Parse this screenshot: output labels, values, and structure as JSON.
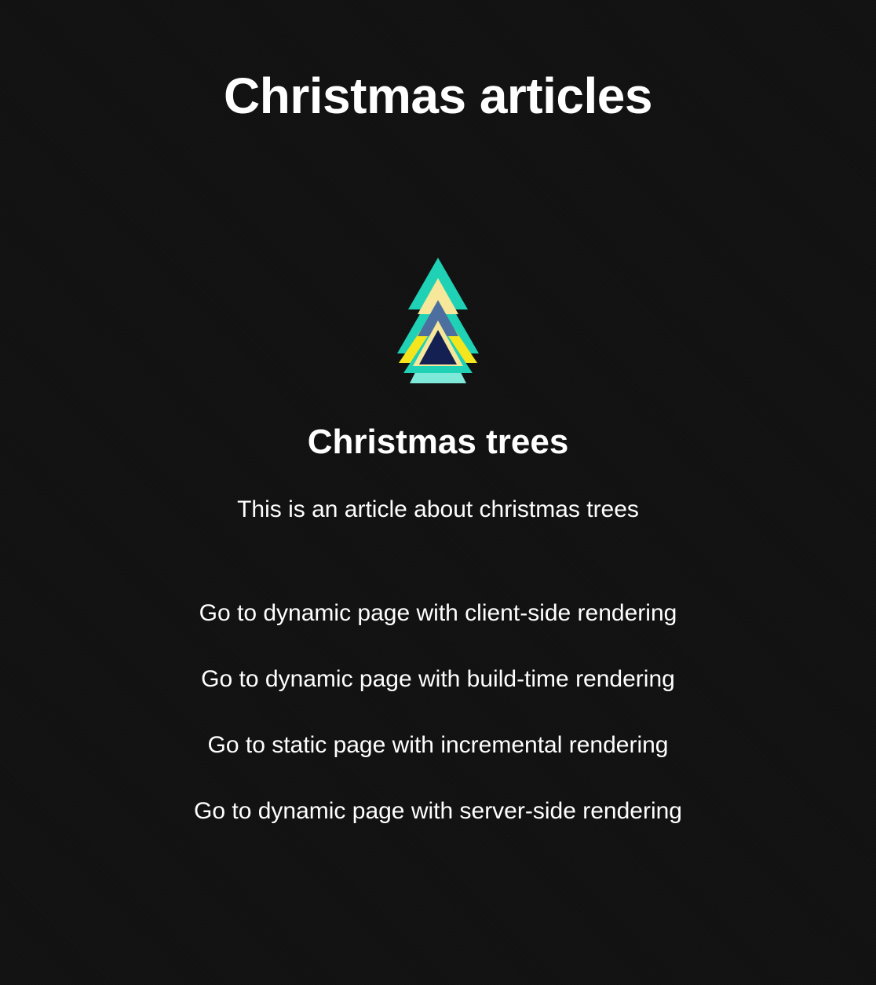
{
  "page": {
    "title": "Christmas articles"
  },
  "article": {
    "icon": "christmas-tree-icon",
    "title": "Christmas trees",
    "description": "This is an article about christmas trees"
  },
  "links": [
    "Go to dynamic page with client-side rendering",
    "Go to dynamic page with build-time rendering",
    "Go to static page with incremental rendering",
    "Go to dynamic page with server-side rendering"
  ],
  "colors": {
    "background": "#111111",
    "text": "#ffffff",
    "tree_teal": "#1fd1b5",
    "tree_light_teal": "#7ee8d9",
    "tree_yellow": "#f5e51c",
    "tree_pale_yellow": "#f6e79a",
    "tree_navy": "#142052",
    "tree_slate": "#4d6fa0"
  }
}
